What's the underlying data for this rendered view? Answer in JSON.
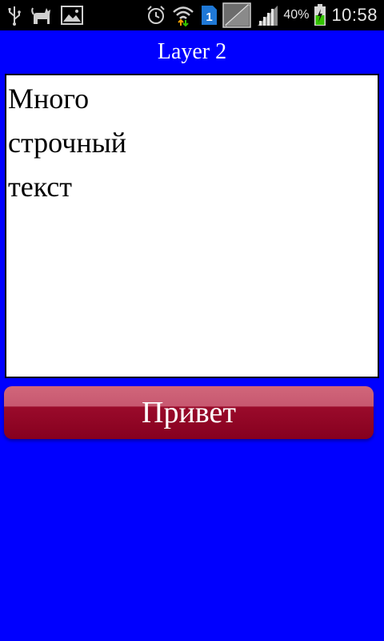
{
  "status_bar": {
    "battery_percent": "40%",
    "time": "10:58",
    "sim_slot": "1",
    "icons": [
      "usb-icon",
      "cat-icon",
      "gallery-icon",
      "alarm-icon",
      "wifi-icon",
      "sim-icon",
      "no-signal-icon",
      "signal-icon",
      "battery-charging-icon"
    ]
  },
  "app": {
    "title": "Layer 2"
  },
  "textarea": {
    "lines": [
      "Много",
      "строчный",
      "текст"
    ]
  },
  "button": {
    "label": "Привет"
  },
  "colors": {
    "background": "#0000ff",
    "status_bar": "#000000",
    "button_top": "#d1667a",
    "button_bottom": "#86001f"
  }
}
